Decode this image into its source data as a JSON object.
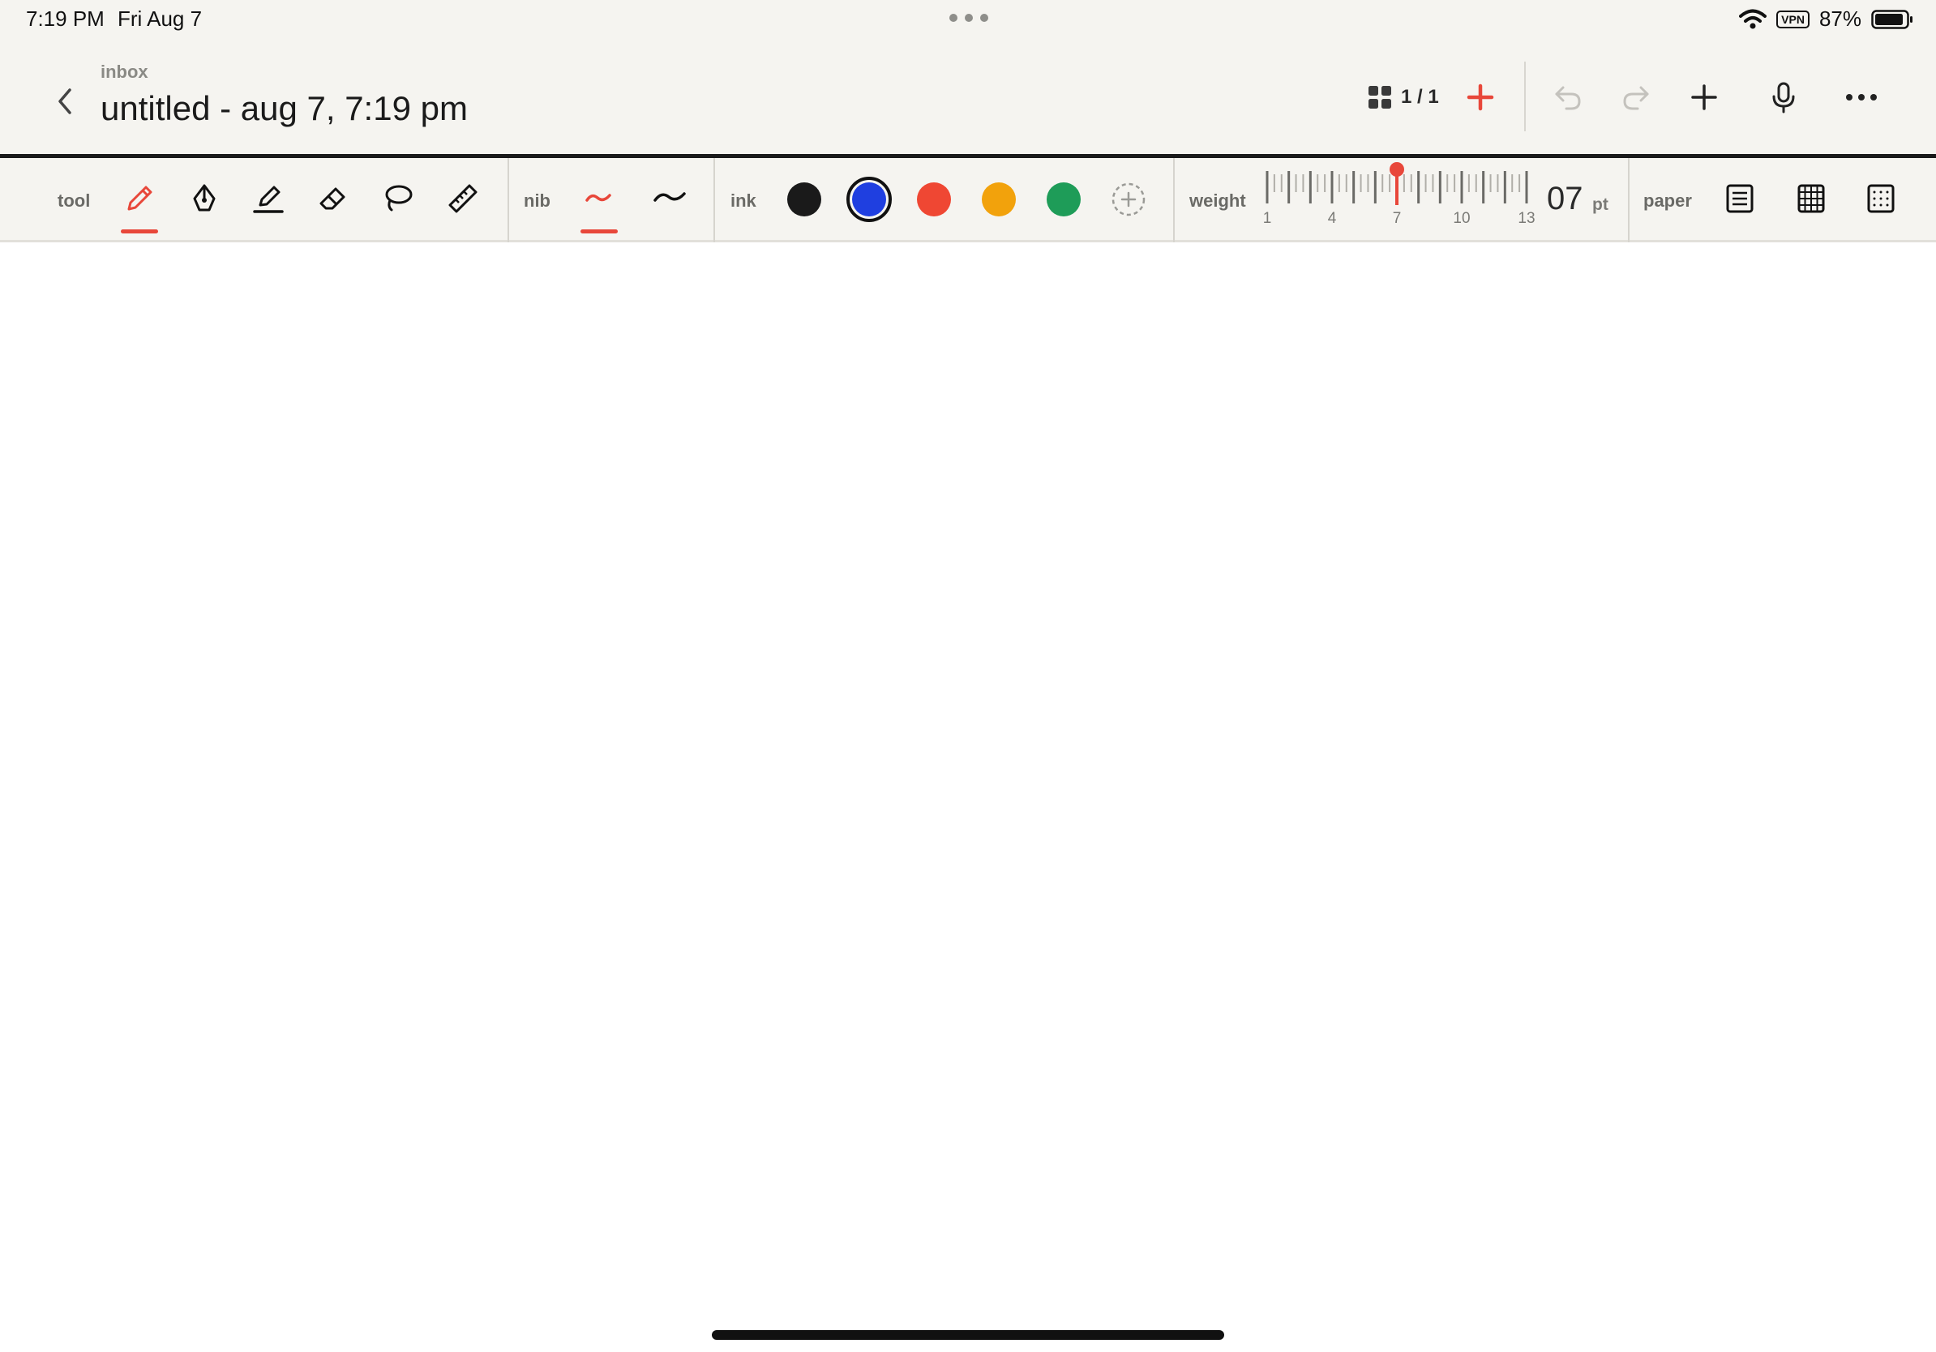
{
  "status_bar": {
    "time": "7:19 PM",
    "date": "Fri Aug 7",
    "vpn": "VPN",
    "battery": "87%"
  },
  "header": {
    "breadcrumb": "inbox",
    "title": "untitled - aug 7, 7:19 pm",
    "page_count": "1 / 1",
    "icons": [
      "back-chevron-icon",
      "pages-grid-icon",
      "add-page-icon",
      "undo-icon",
      "redo-icon",
      "add-icon",
      "microphone-icon",
      "more-icon"
    ]
  },
  "toolbar": {
    "tool_label": "tool",
    "tools": [
      "pencil",
      "fountain-pen",
      "highlighter",
      "eraser",
      "lasso",
      "ruler"
    ],
    "selected_tool": "pencil",
    "nib_label": "nib",
    "nibs": [
      "tapered",
      "uniform"
    ],
    "selected_nib": "tapered",
    "ink_label": "ink",
    "ink_colors": [
      "#1a1a1a",
      "#1f3fe0",
      "#ef4733",
      "#f2a20c",
      "#1e9c58"
    ],
    "selected_ink": "#1f3fe0",
    "weight_label": "weight",
    "weight_ticks": [
      "1",
      "4",
      "7",
      "10",
      "13"
    ],
    "weight_selected": 7,
    "weight_min": 1,
    "weight_max": 13,
    "weight_value": "07",
    "weight_unit": "pt",
    "paper_label": "paper",
    "papers": [
      "lined",
      "grid",
      "dotted"
    ]
  },
  "colors": {
    "accent": "#e8473a",
    "background": "#f5f4f0"
  }
}
